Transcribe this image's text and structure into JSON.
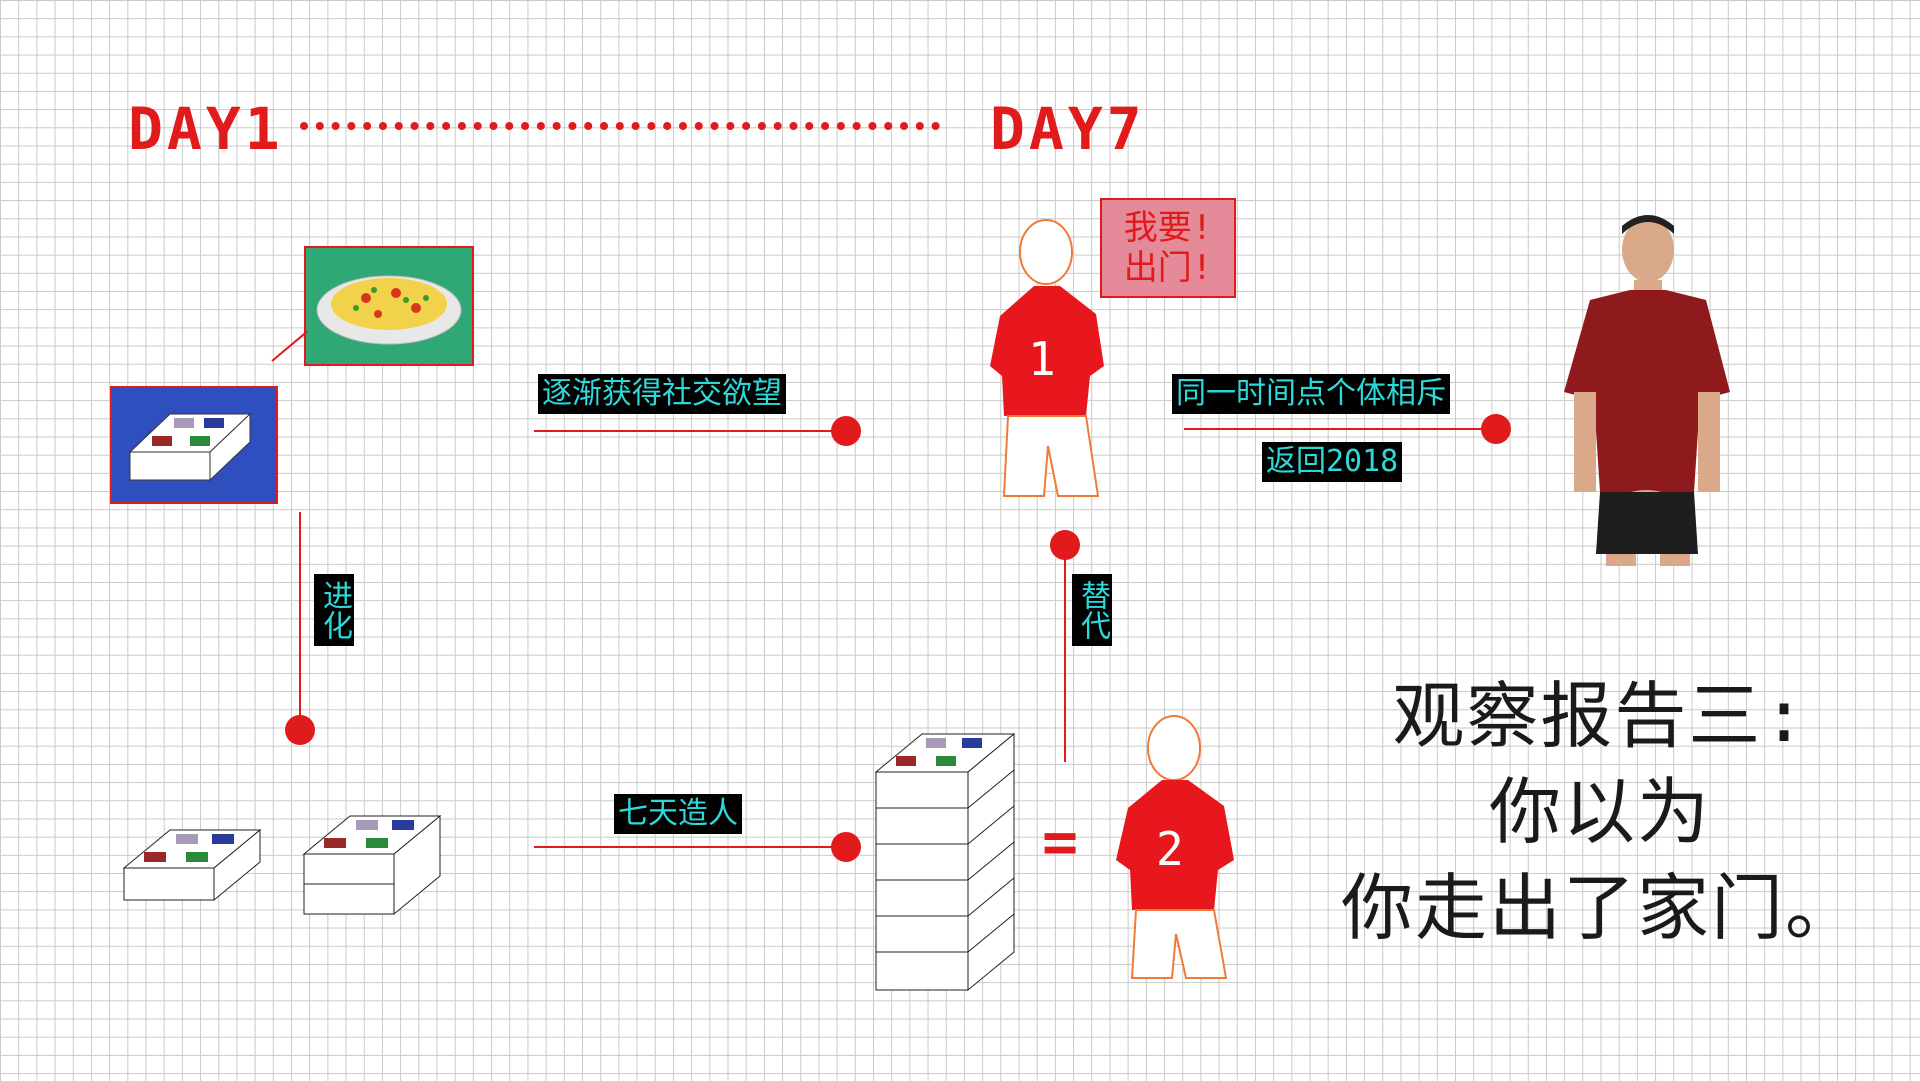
{
  "timeline": {
    "start": "DAY1",
    "end": "DAY7"
  },
  "labels": {
    "social_desire": "逐渐获得社交欲望",
    "unique_time": "同一时间点个体相斥",
    "return_year": "返回2018",
    "evolve": "进化",
    "replace": "替代",
    "seven_days": "七天造人"
  },
  "speech": {
    "line1": "我要!",
    "line2": "出门!"
  },
  "shirt_numbers": {
    "first": "1",
    "second": "2"
  },
  "equals": "=",
  "report": {
    "text": "观察报告三:\n你以为\n你走出了家门。"
  },
  "colors": {
    "accent": "#e11b1b",
    "label_text": "#2fd8d8",
    "label_bg": "#000000",
    "food_bg": "#2fa876",
    "box_bg": "#2f4fbf",
    "shirt": "#e8171d"
  }
}
